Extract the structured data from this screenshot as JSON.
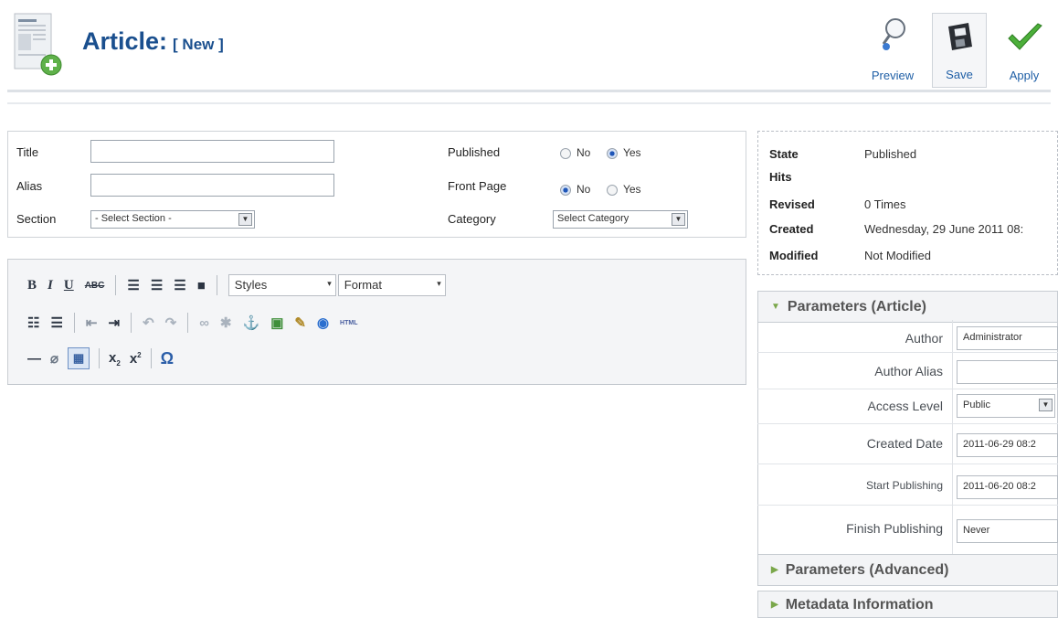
{
  "header": {
    "title": "Article:",
    "subtitle": "[ New ]",
    "toolbar": [
      {
        "id": "preview",
        "label": "Preview",
        "icon": "magnifier-icon"
      },
      {
        "id": "save",
        "label": "Save",
        "icon": "floppy-icon"
      },
      {
        "id": "apply",
        "label": "Apply",
        "icon": "checkmark-icon"
      }
    ]
  },
  "details": {
    "title_label": "Title",
    "title_value": "",
    "alias_label": "Alias",
    "alias_value": "",
    "section_label": "Section",
    "section_value": "- Select Section -",
    "published_label": "Published",
    "published_no": "No",
    "published_yes": "Yes",
    "published_selected": "Yes",
    "frontpage_label": "Front Page",
    "frontpage_no": "No",
    "frontpage_yes": "Yes",
    "frontpage_selected": "No",
    "category_label": "Category",
    "category_value": "Select Category"
  },
  "editor": {
    "styles_value": "Styles",
    "format_value": "Format",
    "content": ""
  },
  "info": {
    "state_label": "State",
    "state_value": "Published",
    "hits_label": "Hits",
    "hits_value": "",
    "revised_label": "Revised",
    "revised_value": "0 Times",
    "created_label": "Created",
    "created_value": "Wednesday, 29 June 2011 08:",
    "modified_label": "Modified",
    "modified_value": "Not Modified"
  },
  "params_article": {
    "heading": "Parameters (Article)",
    "author_label": "Author",
    "author_value": "Administrator",
    "author_alias_label": "Author Alias",
    "author_alias_value": "",
    "access_label": "Access Level",
    "access_value": "Public",
    "created_date_label": "Created Date",
    "created_date_value": "2011-06-29 08:2",
    "start_label": "Start Publishing",
    "start_value": "2011-06-20 08:2",
    "finish_label": "Finish Publishing",
    "finish_value": "Never"
  },
  "params_advanced": {
    "heading": "Parameters (Advanced)"
  },
  "metadata": {
    "heading": "Metadata Information"
  },
  "colors": {
    "title_blue": "#1a4f8e",
    "link_blue": "#1f5fa6",
    "arrow_green": "#7aa74a"
  }
}
